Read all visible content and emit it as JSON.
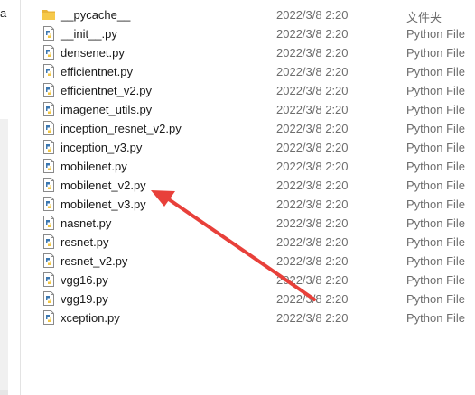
{
  "nav": {
    "fragment": "a"
  },
  "files": [
    {
      "name": "__pycache__",
      "date": "2022/3/8 2:20",
      "type": "文件夹",
      "icon": "folder-icon"
    },
    {
      "name": "__init__.py",
      "date": "2022/3/8 2:20",
      "type": "Python File",
      "icon": "python-file-icon"
    },
    {
      "name": "densenet.py",
      "date": "2022/3/8 2:20",
      "type": "Python File",
      "icon": "python-file-icon"
    },
    {
      "name": "efficientnet.py",
      "date": "2022/3/8 2:20",
      "type": "Python File",
      "icon": "python-file-icon"
    },
    {
      "name": "efficientnet_v2.py",
      "date": "2022/3/8 2:20",
      "type": "Python File",
      "icon": "python-file-icon"
    },
    {
      "name": "imagenet_utils.py",
      "date": "2022/3/8 2:20",
      "type": "Python File",
      "icon": "python-file-icon"
    },
    {
      "name": "inception_resnet_v2.py",
      "date": "2022/3/8 2:20",
      "type": "Python File",
      "icon": "python-file-icon"
    },
    {
      "name": "inception_v3.py",
      "date": "2022/3/8 2:20",
      "type": "Python File",
      "icon": "python-file-icon"
    },
    {
      "name": "mobilenet.py",
      "date": "2022/3/8 2:20",
      "type": "Python File",
      "icon": "python-file-icon"
    },
    {
      "name": "mobilenet_v2.py",
      "date": "2022/3/8 2:20",
      "type": "Python File",
      "icon": "python-file-icon"
    },
    {
      "name": "mobilenet_v3.py",
      "date": "2022/3/8 2:20",
      "type": "Python File",
      "icon": "python-file-icon"
    },
    {
      "name": "nasnet.py",
      "date": "2022/3/8 2:20",
      "type": "Python File",
      "icon": "python-file-icon"
    },
    {
      "name": "resnet.py",
      "date": "2022/3/8 2:20",
      "type": "Python File",
      "icon": "python-file-icon"
    },
    {
      "name": "resnet_v2.py",
      "date": "2022/3/8 2:20",
      "type": "Python File",
      "icon": "python-file-icon"
    },
    {
      "name": "vgg16.py",
      "date": "2022/3/8 2:20",
      "type": "Python File",
      "icon": "python-file-icon"
    },
    {
      "name": "vgg19.py",
      "date": "2022/3/8 2:20",
      "type": "Python File",
      "icon": "python-file-icon"
    },
    {
      "name": "xception.py",
      "date": "2022/3/8 2:20",
      "type": "Python File",
      "icon": "python-file-icon"
    }
  ],
  "annotation": {
    "color": "#e8403a",
    "points_to": "mobilenet_v2.py"
  },
  "colors": {
    "folder": "#f6c94a",
    "python_blue": "#3b77b0",
    "python_yellow": "#f2c744",
    "secondary_text": "#6d6d6d"
  }
}
